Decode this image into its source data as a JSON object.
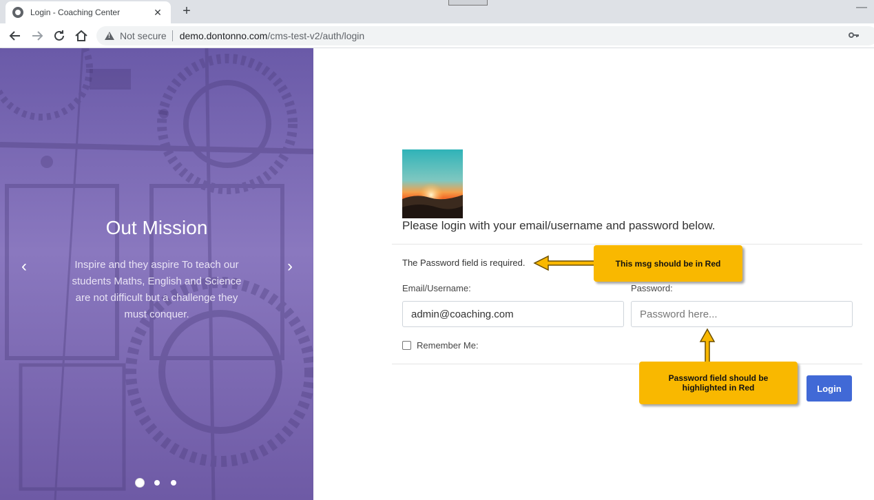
{
  "browser": {
    "tab_title": "Login - Coaching Center",
    "close_tab": "✕",
    "new_tab": "+",
    "security_label": "Not secure",
    "url_host": "demo.dontonno.com",
    "url_path": "/cms-test-v2/auth/login"
  },
  "hero": {
    "title": "Out Mission",
    "text": "Inspire and they aspire To teach our students Maths, English and Science are not difficult but a challenge they must conquer.",
    "prev": "‹",
    "next": "›",
    "slide_count": 3,
    "active_slide": 1
  },
  "login": {
    "intro": "Please login with your email/username and password below.",
    "error_message": "The Password field is required.",
    "email_label": "Email/Username:",
    "email_value": "admin@coaching.com",
    "password_label": "Password:",
    "password_placeholder": "Password here...",
    "remember_label": "Remember Me:",
    "remember_checked": false,
    "submit_label": "Login"
  },
  "annotations": {
    "error_note": "This msg should be in Red",
    "password_note": "Password field should be highlighted in Red"
  },
  "colors": {
    "accent": "#4169d6",
    "callout": "#f9b800",
    "hero": "#7a68b5"
  }
}
